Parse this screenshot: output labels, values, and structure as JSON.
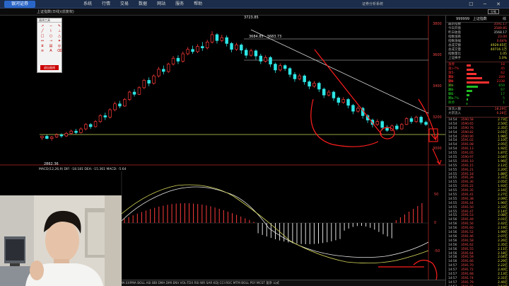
{
  "app": {
    "logo": "银河证券",
    "menu": [
      "系统",
      "行情",
      "交易",
      "数据",
      "网站",
      "服务",
      "帮助"
    ],
    "center_title": "证券分析系统",
    "window_controls": "☐ ─ ✕"
  },
  "subbar": {
    "title": "上证指数(日线)(前复权)",
    "btn": "分笔"
  },
  "chart": {
    "high_label": "3723.85",
    "low_label": "2862.36",
    "trend_label": "3684.85 - 3683.73",
    "price_axis": [
      "3800",
      "3600",
      "3400",
      "3200",
      "3000"
    ],
    "macd_label": "MACD(12,26,9) DIF: -18.181  DEA: -15.361  MACD: -5.64",
    "macd_axis": [
      "50",
      "0",
      "-50"
    ],
    "date_labels": [
      "11-06",
      "11-16",
      "12-01",
      "12-16",
      "01-04",
      "01-16",
      "02-01",
      "02-16",
      "03-01",
      "03-16",
      "04-01",
      "04-16",
      "05-06",
      "05-16",
      "06-01",
      "06-16",
      "07-01"
    ]
  },
  "chart_data": {
    "type": "candlestick",
    "candles": [
      [
        3000,
        3010,
        2985,
        3015
      ],
      [
        3010,
        2995,
        2990,
        3020
      ],
      [
        2995,
        3005,
        2980,
        3012
      ],
      [
        3005,
        3020,
        2998,
        3030
      ],
      [
        3020,
        3012,
        3000,
        3030
      ],
      [
        3012,
        3030,
        3005,
        3040
      ],
      [
        3030,
        3045,
        3020,
        3055
      ],
      [
        3045,
        3035,
        3025,
        3060
      ],
      [
        3035,
        3060,
        3030,
        3070
      ],
      [
        3060,
        3090,
        3050,
        3100
      ],
      [
        3090,
        3075,
        3060,
        3100
      ],
      [
        3075,
        3110,
        3070,
        3120
      ],
      [
        3110,
        3150,
        3100,
        3160
      ],
      [
        3150,
        3140,
        3120,
        3170
      ],
      [
        3140,
        3190,
        3130,
        3200
      ],
      [
        3190,
        3230,
        3180,
        3245
      ],
      [
        3230,
        3215,
        3200,
        3250
      ],
      [
        3215,
        3260,
        3210,
        3270
      ],
      [
        3260,
        3310,
        3250,
        3320
      ],
      [
        3310,
        3295,
        3280,
        3330
      ],
      [
        3295,
        3340,
        3290,
        3350
      ],
      [
        3340,
        3390,
        3330,
        3400
      ],
      [
        3390,
        3370,
        3350,
        3410
      ],
      [
        3370,
        3420,
        3360,
        3430
      ],
      [
        3420,
        3465,
        3410,
        3480
      ],
      [
        3465,
        3450,
        3430,
        3490
      ],
      [
        3450,
        3500,
        3440,
        3510
      ],
      [
        3500,
        3540,
        3490,
        3555
      ],
      [
        3540,
        3520,
        3500,
        3560
      ],
      [
        3520,
        3570,
        3510,
        3585
      ],
      [
        3570,
        3600,
        3560,
        3615
      ],
      [
        3600,
        3585,
        3570,
        3625
      ],
      [
        3585,
        3620,
        3575,
        3635
      ],
      [
        3620,
        3610,
        3590,
        3650
      ],
      [
        3610,
        3650,
        3600,
        3665
      ],
      [
        3650,
        3700,
        3640,
        3723
      ],
      [
        3700,
        3660,
        3640,
        3710
      ],
      [
        3660,
        3680,
        3650,
        3700
      ],
      [
        3680,
        3640,
        3620,
        3695
      ],
      [
        3640,
        3600,
        3580,
        3650
      ],
      [
        3600,
        3630,
        3590,
        3645
      ],
      [
        3630,
        3595,
        3570,
        3640
      ],
      [
        3595,
        3560,
        3540,
        3610
      ],
      [
        3560,
        3590,
        3550,
        3605
      ],
      [
        3590,
        3555,
        3530,
        3600
      ],
      [
        3555,
        3520,
        3500,
        3570
      ],
      [
        3520,
        3545,
        3510,
        3560
      ],
      [
        3545,
        3500,
        3480,
        3555
      ],
      [
        3500,
        3460,
        3440,
        3510
      ],
      [
        3460,
        3490,
        3450,
        3505
      ],
      [
        3490,
        3470,
        3455,
        3500
      ],
      [
        3470,
        3430,
        3410,
        3480
      ],
      [
        3430,
        3400,
        3380,
        3445
      ],
      [
        3400,
        3420,
        3390,
        3435
      ],
      [
        3420,
        3380,
        3360,
        3430
      ],
      [
        3380,
        3350,
        3330,
        3390
      ],
      [
        3350,
        3370,
        3340,
        3385
      ],
      [
        3370,
        3330,
        3310,
        3380
      ],
      [
        3330,
        3290,
        3270,
        3340
      ],
      [
        3290,
        3310,
        3280,
        3325
      ],
      [
        3310,
        3270,
        3250,
        3320
      ],
      [
        3270,
        3240,
        3220,
        3280
      ],
      [
        3240,
        3260,
        3230,
        3275
      ],
      [
        3260,
        3220,
        3200,
        3270
      ],
      [
        3220,
        3180,
        3160,
        3230
      ],
      [
        3180,
        3200,
        3170,
        3215
      ],
      [
        3200,
        3150,
        3130,
        3210
      ],
      [
        3150,
        3120,
        3100,
        3160
      ],
      [
        3120,
        3090,
        3070,
        3130
      ],
      [
        3090,
        3110,
        3080,
        3125
      ],
      [
        3110,
        3070,
        3050,
        3120
      ],
      [
        3070,
        3050,
        3040,
        3085
      ],
      [
        3050,
        3080,
        3045,
        3090
      ],
      [
        3080,
        3060,
        3050,
        3095
      ],
      [
        3060,
        3090,
        3055,
        3100
      ],
      [
        3090,
        3130,
        3085,
        3140
      ],
      [
        3130,
        3110,
        3095,
        3145
      ],
      [
        3110,
        3140,
        3100,
        3150
      ],
      [
        3140,
        3105,
        3090,
        3150
      ],
      [
        3105,
        3090,
        3080,
        3115
      ]
    ],
    "ylim": [
      2820,
      3820
    ]
  },
  "side": {
    "code": "999999",
    "name": "上证指数",
    "mark": "综",
    "quote": [
      {
        "k": "最新指数",
        "v": "3591.17",
        "c": "r"
      },
      {
        "k": "今日开盘",
        "v": "3589.85",
        "c": "r"
      },
      {
        "k": "昨日收盘",
        "v": "3568.17",
        "c": "w"
      },
      {
        "k": "指数涨跌",
        "v": "23.00",
        "c": "r"
      },
      {
        "k": "指数涨幅",
        "v": "0.64%",
        "c": "r"
      },
      {
        "k": "总成交额",
        "v": "4929.65亿",
        "c": "y"
      },
      {
        "k": "总成交量",
        "v": "40716.1万",
        "c": "y"
      },
      {
        "k": "指数量比",
        "v": "1.05",
        "c": "y"
      },
      {
        "k": "上证换手",
        "v": "1.0%",
        "c": "y"
      }
    ],
    "dist": [
      {
        "k": "涨停",
        "n": "18",
        "w": 6,
        "col": "#ff3030"
      },
      {
        "k": "涨>7%",
        "n": "45",
        "w": 10,
        "col": "#ff3030"
      },
      {
        "k": "涨5-7%",
        "n": "62",
        "w": 14,
        "col": "#ff3030"
      },
      {
        "k": "涨3-5%",
        "n": "289",
        "w": 22,
        "col": "#ff3030"
      },
      {
        "k": "涨0-3%",
        "n": "2338",
        "w": 32,
        "col": "#ff3030"
      },
      {
        "k": "跌0-3%",
        "n": "659",
        "w": 16,
        "col": "#22bb22"
      },
      {
        "k": "跌3-5%",
        "n": "67",
        "w": 8,
        "col": "#22bb22"
      },
      {
        "k": "跌5-7%",
        "n": "17",
        "w": 4,
        "col": "#22bb22"
      },
      {
        "k": "跌>7%",
        "n": "5",
        "w": 2,
        "col": "#22bb22"
      },
      {
        "k": "跌停",
        "n": "1",
        "w": 1,
        "col": "#22bb22"
      }
    ],
    "flow": [
      {
        "k": "净流入额",
        "v": "18.29亿",
        "c": "r"
      },
      {
        "k": "大宗流入",
        "v": "0.26亿",
        "c": "r"
      }
    ],
    "ticks": [
      [
        "14:54",
        "3590.58",
        "2.73亿"
      ],
      [
        "14:54",
        "3590.65",
        "2.50亿"
      ],
      [
        "14:54",
        "3590.76",
        "2.35亿"
      ],
      [
        "14:54",
        "3590.82",
        "2.01亿"
      ],
      [
        "14:54",
        "3590.90",
        "1.98亿"
      ],
      [
        "14:54",
        "3591.02",
        "2.10亿"
      ],
      [
        "14:54",
        "3591.08",
        "2.05亿"
      ],
      [
        "14:54",
        "3591.13",
        "1.92亿"
      ],
      [
        "14:55",
        "3591.05",
        "1.87亿"
      ],
      [
        "14:55",
        "3590.97",
        "2.04亿"
      ],
      [
        "14:55",
        "3591.10",
        "1.96亿"
      ],
      [
        "14:55",
        "3591.15",
        "2.12亿"
      ],
      [
        "14:55",
        "3591.21",
        "2.20亿"
      ],
      [
        "14:55",
        "3591.18",
        "1.88亿"
      ],
      [
        "14:55",
        "3591.26",
        "2.31亿"
      ],
      [
        "14:55",
        "3591.30",
        "2.05亿"
      ],
      [
        "14:55",
        "3591.22",
        "1.93亿"
      ],
      [
        "14:55",
        "3591.35",
        "2.16亿"
      ],
      [
        "14:55",
        "3591.41",
        "2.27亿"
      ],
      [
        "14:55",
        "3591.38",
        "2.09亿"
      ],
      [
        "14:55",
        "3591.44",
        "1.96亿"
      ],
      [
        "14:55",
        "3591.50",
        "2.33亿"
      ],
      [
        "14:55",
        "3591.47",
        "2.14亿"
      ],
      [
        "14:55",
        "3591.53",
        "2.08亿"
      ],
      [
        "14:56",
        "3591.49",
        "2.01亿"
      ],
      [
        "14:56",
        "3591.56",
        "2.42亿"
      ],
      [
        "14:56",
        "3591.60",
        "2.19亿"
      ],
      [
        "14:56",
        "3591.52",
        "1.99亿"
      ],
      [
        "14:56",
        "3591.46",
        "2.07亿"
      ],
      [
        "14:56",
        "3591.58",
        "2.26亿"
      ],
      [
        "14:56",
        "3591.62",
        "2.35亿"
      ],
      [
        "14:56",
        "3591.55",
        "2.11亿"
      ],
      [
        "14:56",
        "3591.64",
        "2.18亿"
      ],
      [
        "14:56",
        "3591.59",
        "2.04亿"
      ],
      [
        "14:56",
        "3591.66",
        "2.29亿"
      ],
      [
        "14:57",
        "3591.70",
        "2.22亿"
      ],
      [
        "14:57",
        "3591.72",
        "2.40亿"
      ],
      [
        "14:57",
        "3591.68",
        "2.13亿"
      ],
      [
        "14:57",
        "3591.74",
        "2.31亿"
      ],
      [
        "14:57",
        "3591.79",
        "2.46亿"
      ],
      [
        "14:57",
        "3591.81",
        "2.52亿"
      ],
      [
        "14:57",
        "3591.90",
        "4.86亿"
      ],
      [
        "15:00",
        "3591.17",
        "47.33亿"
      ]
    ]
  },
  "bottombar": "模版 MA  EXPMA BOLL  ASI  BBI  DMA  DMI  ENV  VOL-TDX  RSI  WR  SAR  KDJ  CCI  ROC  MTM  BOLL  PSY  MCST  复杂  公式",
  "toolbox": {
    "title": "画线工具",
    "items": [
      "↗",
      "─",
      "✎",
      "╱",
      "⌇",
      "⊥",
      "□",
      "○",
      "△",
      "↔",
      "⇢",
      "✦",
      "⧖",
      "▤",
      "◎",
      "≋",
      "A",
      "⌫"
    ],
    "close": "退出画线"
  }
}
